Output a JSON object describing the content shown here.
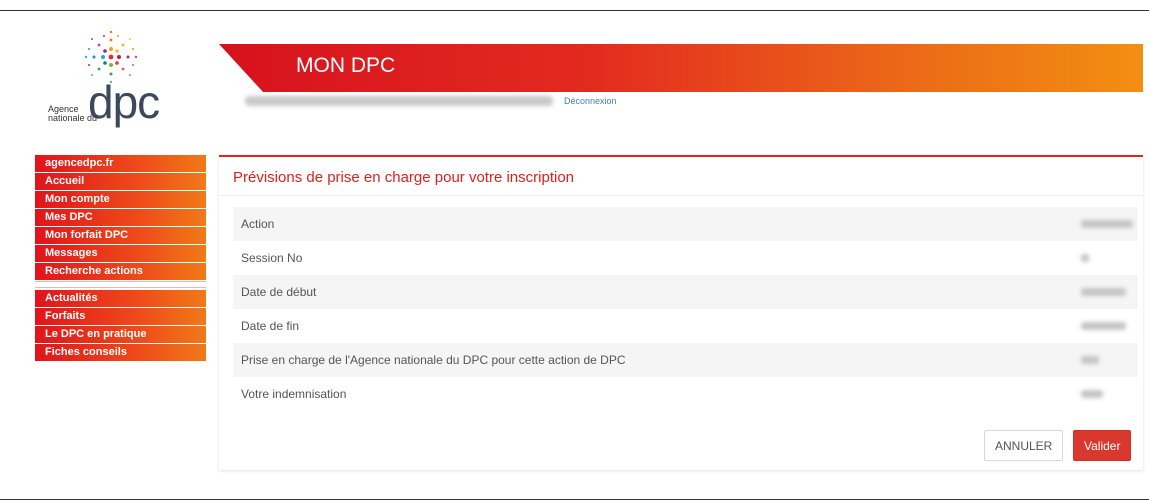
{
  "logo": {
    "line1": "Agence",
    "line2": "nationale du",
    "word": "dpc"
  },
  "header": {
    "title": "MON DPC",
    "logout_label": "Déconnexion"
  },
  "sidebar": {
    "items": [
      {
        "label": "agencedpc.fr"
      },
      {
        "label": "Accueil"
      },
      {
        "label": "Mon compte"
      },
      {
        "label": "Mes DPC"
      },
      {
        "label": "Mon forfait DPC"
      },
      {
        "label": "Messages"
      },
      {
        "label": "Recherche actions"
      }
    ],
    "items2": [
      {
        "label": "Actualités"
      },
      {
        "label": "Forfaits"
      },
      {
        "label": "Le DPC en pratique"
      },
      {
        "label": "Fiches conseils"
      }
    ]
  },
  "panel": {
    "title": "Prévisions de prise en charge pour votre inscription",
    "rows": [
      {
        "label": "Action"
      },
      {
        "label": "Session No"
      },
      {
        "label": "Date de début"
      },
      {
        "label": "Date de fin"
      },
      {
        "label": "Prise en charge de l'Agence nationale du DPC pour cette action de DPC"
      },
      {
        "label": "Votre indemnisation"
      }
    ],
    "cancel_label": "ANNULER",
    "validate_label": "Valider"
  },
  "colors": {
    "brand_red": "#e0141c",
    "brand_orange": "#f28f11",
    "validate_button": "#d9382f",
    "link_blue": "#4a7ac4"
  }
}
